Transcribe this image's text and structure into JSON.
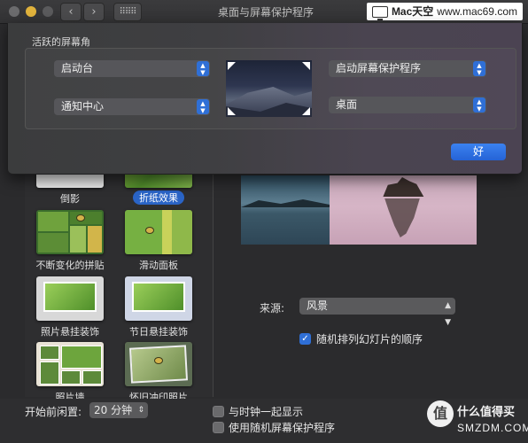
{
  "window": {
    "title": "桌面与屏幕保护程序",
    "grid_glyph": "⠿⠿⠿",
    "back_glyph": "‹",
    "forward_glyph": "›"
  },
  "watermark": {
    "brand": "Mac天空",
    "url": "www.mac69.com"
  },
  "screensavers": [
    {
      "label": "倒影"
    },
    {
      "label": "折纸效果",
      "selected": true
    },
    {
      "label": "不断变化的拼贴"
    },
    {
      "label": "滑动面板"
    },
    {
      "label": "照片悬挂装饰"
    },
    {
      "label": "节日悬挂装饰"
    },
    {
      "label": "照片墙"
    },
    {
      "label": "怀旧冲印照片"
    }
  ],
  "source": {
    "label": "来源:",
    "value": "风景"
  },
  "shuffle": {
    "label": "随机排列幻灯片的顺序",
    "checked": true
  },
  "bottom": {
    "start_label": "开始前闲置:",
    "start_value": "20 分钟",
    "show_clock": {
      "label": "与时钟一起显示",
      "checked": false
    },
    "random_saver": {
      "label": "使用随机屏幕保护程序",
      "checked": false
    }
  },
  "hot_corners": {
    "title": "活跃的屏幕角",
    "top_left": "启动台",
    "bottom_left": "通知中心",
    "top_right": "启动屏幕保护程序",
    "bottom_right": "桌面",
    "ok": "好"
  },
  "smzdm": {
    "circle": "值",
    "line1": "什么值得买",
    "line2": "SMZDM.COM"
  },
  "colors": {
    "accent": "#2f6fd6",
    "selected_label": "#2a64c6"
  }
}
